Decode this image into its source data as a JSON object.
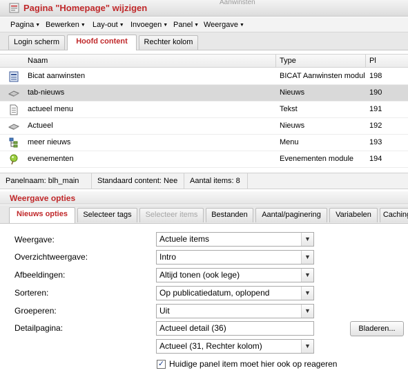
{
  "window": {
    "title": "Pagina \"Homepage\" wijzigen",
    "ghost_text": "Aanwinsten"
  },
  "menu": [
    {
      "label": "Pagina",
      "name": "menu-pagina"
    },
    {
      "label": "Bewerken",
      "name": "menu-bewerken"
    },
    {
      "label": "Lay-out",
      "name": "menu-layout"
    },
    {
      "label": "Invoegen",
      "name": "menu-invoegen"
    },
    {
      "label": "Panel",
      "name": "menu-panel"
    },
    {
      "label": "Weergave",
      "name": "menu-weergave"
    }
  ],
  "panel_tabs": [
    {
      "label": "Login scherm",
      "active": false
    },
    {
      "label": "Hoofd content",
      "active": true
    },
    {
      "label": "Rechter kolom",
      "active": false
    }
  ],
  "grid": {
    "columns": {
      "name": "Naam",
      "type": "Type",
      "pl": "Pl"
    },
    "rows": [
      {
        "name": "Bicat aanwinsten",
        "type": "BICAT Aanwinsten module",
        "pl": "198",
        "icon": "module-icon",
        "selected": false
      },
      {
        "name": "tab-nieuws",
        "type": "Nieuws",
        "pl": "190",
        "icon": "news-icon",
        "selected": true
      },
      {
        "name": "actueel menu",
        "type": "Tekst",
        "pl": "191",
        "icon": "text-document-icon",
        "selected": false
      },
      {
        "name": "Actueel",
        "type": "Nieuws",
        "pl": "192",
        "icon": "news-icon",
        "selected": false
      },
      {
        "name": "meer nieuws",
        "type": "Menu",
        "pl": "193",
        "icon": "menu-tree-icon",
        "selected": false
      },
      {
        "name": "evenementen",
        "type": "Evenementen module",
        "pl": "194",
        "icon": "event-pin-icon",
        "selected": false
      }
    ]
  },
  "status": {
    "panelnaam": "Panelnaam: blh_main",
    "standaard": "Standaard content: Nee",
    "aantal": "Aantal items: 8"
  },
  "options": {
    "title": "Weergave opties",
    "tabs": [
      {
        "label": "Nieuws opties",
        "state": "active"
      },
      {
        "label": "Selecteer tags",
        "state": "normal"
      },
      {
        "label": "Selecteer items",
        "state": "disabled"
      },
      {
        "label": "Bestanden",
        "state": "normal"
      },
      {
        "label": "Aantal/paginering",
        "state": "normal"
      },
      {
        "label": "Variabelen",
        "state": "normal"
      },
      {
        "label": "Caching",
        "state": "normal"
      }
    ],
    "fields": {
      "weergave": {
        "label": "Weergave:",
        "value": "Actuele items"
      },
      "overzicht": {
        "label": "Overzichtweergave:",
        "value": "Intro"
      },
      "afbeeldingen": {
        "label": "Afbeeldingen:",
        "value": "Altijd tonen (ook lege)"
      },
      "sorteren": {
        "label": "Sorteren:",
        "value": "Op publicatiedatum, oplopend"
      },
      "groeperen": {
        "label": "Groeperen:",
        "value": "Uit"
      },
      "detailpagina": {
        "label": "Detailpagina:",
        "value": "Actueel detail (36)"
      },
      "detail_panel": {
        "value": "Actueel (31, Rechter kolom)"
      }
    },
    "browse_button": "Bladeren...",
    "checkbox": {
      "label": "Huidige panel item moet hier ook op reageren",
      "checked": true,
      "mark": "✓"
    }
  }
}
